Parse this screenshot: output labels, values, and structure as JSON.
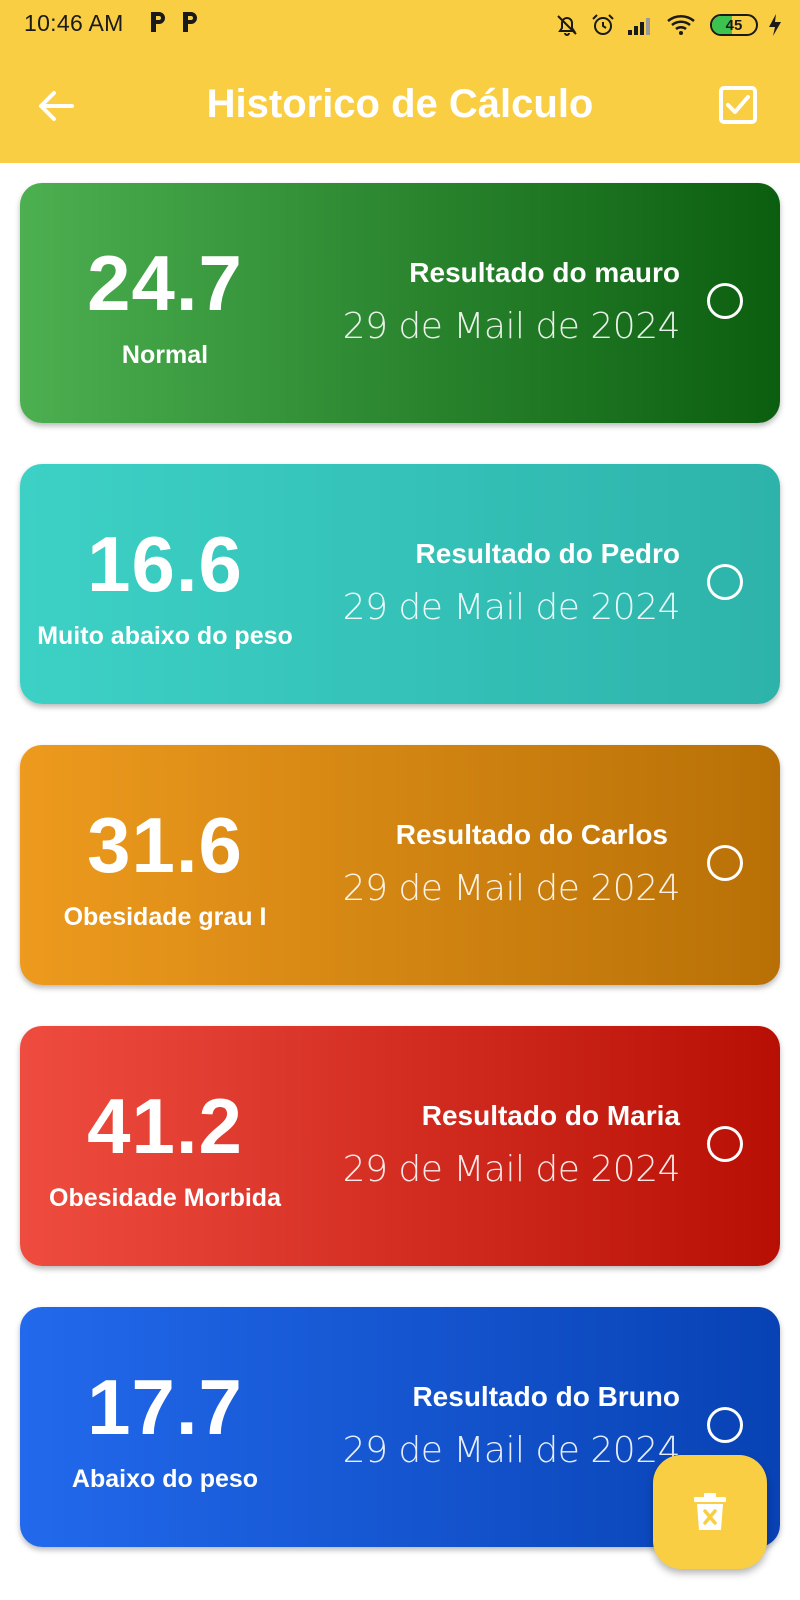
{
  "status_bar": {
    "time": "10:46 AM",
    "battery": "45",
    "battery_level": 0.45
  },
  "appbar": {
    "title": "Historico de Cálculo",
    "color": "#F9CE43"
  },
  "cards": [
    {
      "bmi": "24.7",
      "classification": "Normal",
      "title": "Resultado do mauro",
      "date": "29 de Mail de 2024",
      "gradient": [
        "#4CAF50",
        "#0B5E0F"
      ],
      "selected": false
    },
    {
      "bmi": "16.6",
      "classification": "Muito abaixo do peso",
      "title": "Resultado do Pedro",
      "date": "29 de Mail de 2024",
      "gradient": [
        "#3DD1C6",
        "#2DB3AA"
      ],
      "selected": false
    },
    {
      "bmi": "31.6",
      "classification": "Obesidade grau I",
      "title": "Resultado do Carlos",
      "date": "29 de Mail de 2024",
      "gradient": [
        "#ED9A1E",
        "#B87006"
      ],
      "selected": false
    },
    {
      "bmi": "41.2",
      "classification": "Obesidade Morbida",
      "title": "Resultado do Maria",
      "date": "29 de Mail de 2024",
      "gradient": [
        "#EF4C40",
        "#B80F04"
      ],
      "selected": false
    },
    {
      "bmi": "17.7",
      "classification": "Abaixo do peso",
      "title": "Resultado do Bruno",
      "date": "29 de Mail de 2024",
      "gradient": [
        "#2269EC",
        "#0842B4"
      ],
      "selected": false
    }
  ],
  "fab": {
    "icon": "delete-icon"
  }
}
